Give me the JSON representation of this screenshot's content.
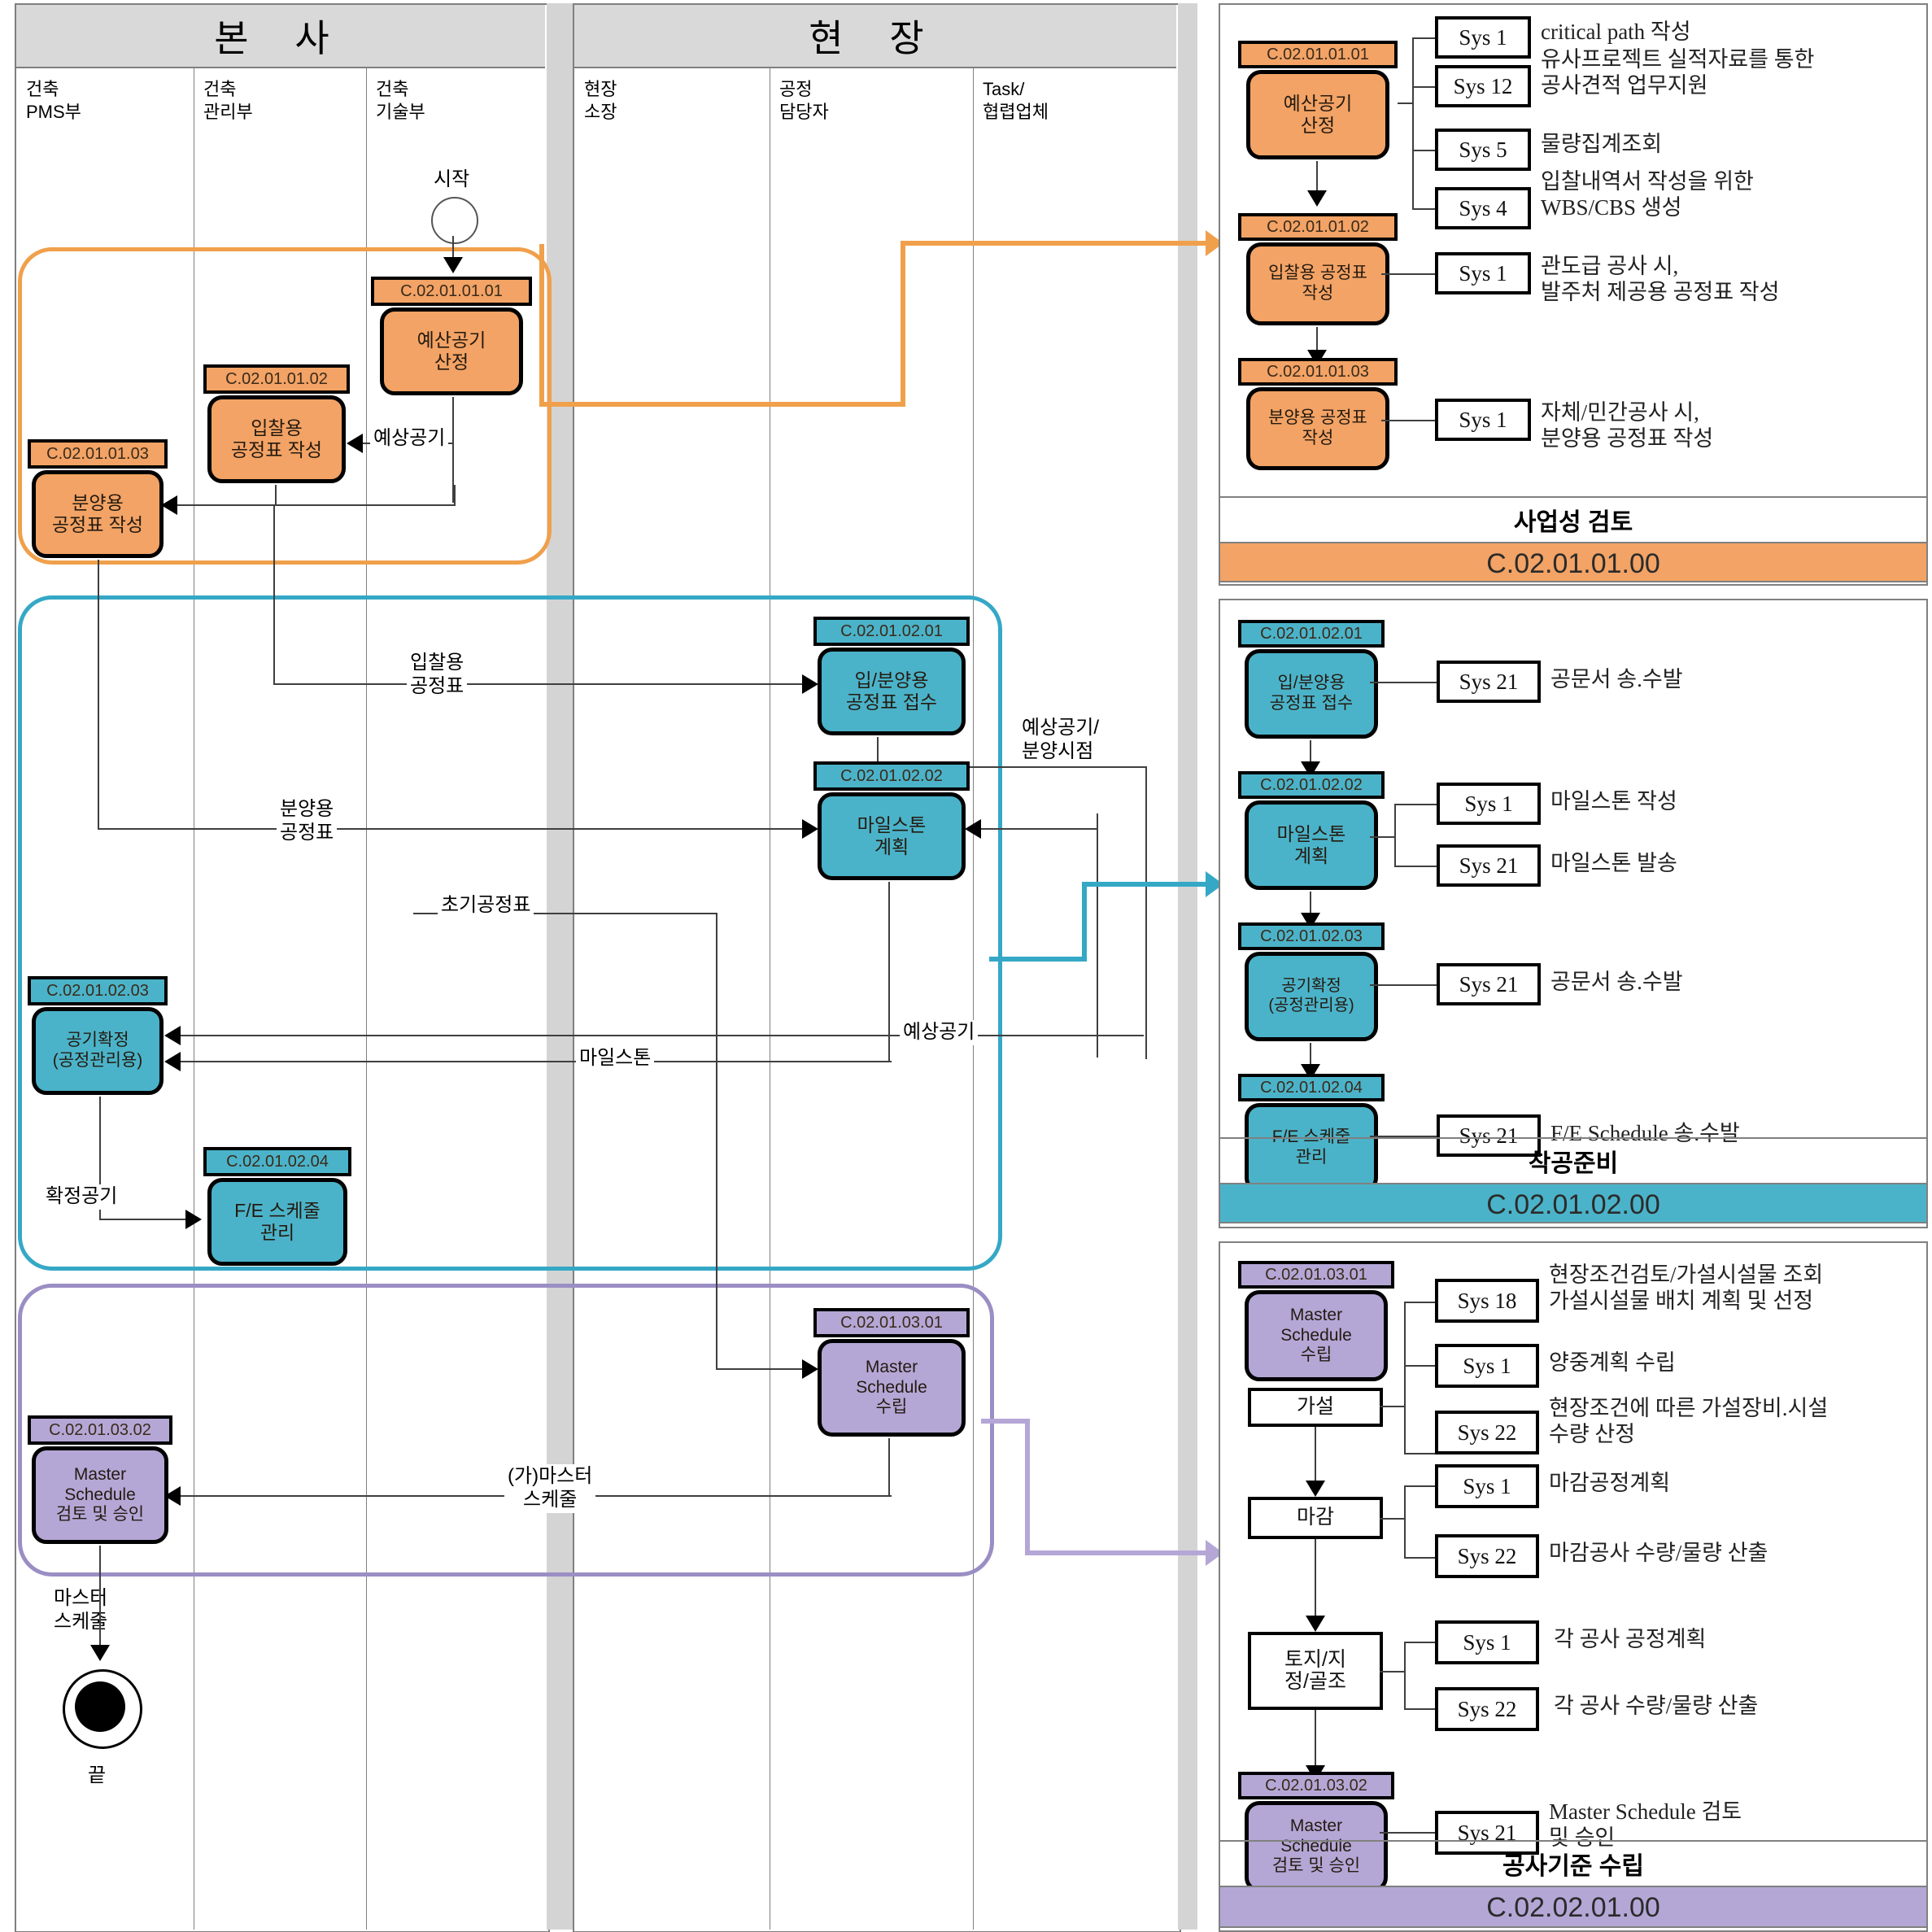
{
  "colors": {
    "orange": "#f2a365",
    "orange_outline": "#f0a04b",
    "blue": "#4bb3c9",
    "blue_outline": "#35a8c6",
    "purple": "#b4a7d6",
    "purple_outline": "#9b8ec4",
    "lane_header_bg": "#d9d9d9"
  },
  "lane_groups": [
    {
      "title": "본  사",
      "columns": [
        "건축\nPMS부",
        "건축\n관리부",
        "건축\n기술부"
      ]
    },
    {
      "title": "현  장",
      "columns": [
        "현장\n소장",
        "공정\n담당자",
        "Task/\n협렵업체"
      ]
    }
  ],
  "start": {
    "label": "시작"
  },
  "end": {
    "label": "끝"
  },
  "flow_nodes": [
    {
      "id": "n1",
      "code": "C.02.01.01.01",
      "label": "예산공기\n산정",
      "phase": "orange"
    },
    {
      "id": "n2",
      "code": "C.02.01.01.02",
      "label": "입찰용\n공정표 작성",
      "phase": "orange"
    },
    {
      "id": "n3",
      "code": "C.02.01.01.03",
      "label": "분양용\n공정표 작성",
      "phase": "orange"
    },
    {
      "id": "n4",
      "code": "C.02.01.02.01",
      "label": "입/분양용\n공정표 접수",
      "phase": "blue"
    },
    {
      "id": "n5",
      "code": "C.02.01.02.02",
      "label": "마일스톤\n계획",
      "phase": "blue"
    },
    {
      "id": "n6",
      "code": "C.02.01.02.03",
      "label": "공기확정\n(공정관리용)",
      "phase": "blue"
    },
    {
      "id": "n7",
      "code": "C.02.01.02.04",
      "label": "F/E 스케줄\n관리",
      "phase": "blue"
    },
    {
      "id": "n8",
      "code": "C.02.01.03.01",
      "label": "Master\nSchedule\n수립",
      "phase": "purple"
    },
    {
      "id": "n9",
      "code": "C.02.01.03.02",
      "label": "Master\nSchedule\n검토 및 승인",
      "phase": "purple"
    }
  ],
  "flow_edge_labels": [
    "예상공기",
    "입찰용\n공정표",
    "분양용\n공정표",
    "예상공기/\n분양시점",
    "초기공정표",
    "마일스톤",
    "예상공기",
    "확정공기",
    "(가)마스터\n스케줄",
    "마스터\n스케줄"
  ],
  "panels": [
    {
      "id": "panel-orange",
      "phase": "orange",
      "title": "사업성 검토",
      "code": "C.02.01.01.00",
      "nodes": [
        {
          "code": "C.02.01.01.01",
          "label": "예산공기\n산정",
          "systems": [
            {
              "sys": "Sys 1",
              "desc": "critical path 작성"
            },
            {
              "sys": "Sys 12",
              "desc": "유사프로젝트 실적자료를 통한\n공사견적 업무지원"
            },
            {
              "sys": "Sys 5",
              "desc": "물량집계조회"
            },
            {
              "sys": "Sys 4",
              "desc": "입찰내역서 작성을 위한\nWBS/CBS 생성"
            }
          ]
        },
        {
          "code": "C.02.01.01.02",
          "label": "입찰용 공정표\n작성",
          "systems": [
            {
              "sys": "Sys 1",
              "desc": "관도급 공사 시,\n발주처 제공용 공정표 작성"
            }
          ]
        },
        {
          "code": "C.02.01.01.03",
          "label": "분양용 공정표\n작성",
          "systems": [
            {
              "sys": "Sys 1",
              "desc": "자체/민간공사 시,\n분양용 공정표 작성"
            }
          ]
        }
      ]
    },
    {
      "id": "panel-blue",
      "phase": "blue",
      "title": "착공준비",
      "code": "C.02.01.02.00",
      "nodes": [
        {
          "code": "C.02.01.02.01",
          "label": "입/분양용\n공정표 접수",
          "systems": [
            {
              "sys": "Sys 21",
              "desc": "공문서 송.수발"
            }
          ]
        },
        {
          "code": "C.02.01.02.02",
          "label": "마일스톤\n계획",
          "systems": [
            {
              "sys": "Sys 1",
              "desc": "마일스톤 작성"
            },
            {
              "sys": "Sys 21",
              "desc": "마일스톤 발송"
            }
          ]
        },
        {
          "code": "C.02.01.02.03",
          "label": "공기확정\n(공정관리용)",
          "systems": [
            {
              "sys": "Sys 21",
              "desc": "공문서 송.수발"
            }
          ]
        },
        {
          "code": "C.02.01.02.04",
          "label": "F/E 스케줄\n관리",
          "systems": [
            {
              "sys": "Sys 21",
              "desc": "F/E Schedule 송.수발"
            }
          ]
        }
      ]
    },
    {
      "id": "panel-purple",
      "phase": "purple",
      "title": "공사기준 수립",
      "code": "C.02.02.01.00",
      "nodes": [
        {
          "code": "C.02.01.03.01",
          "label": "Master\nSchedule\n수립",
          "systems": [
            {
              "sys": "Sys 18",
              "desc": "현장조건검토/가설시설물 조회\n가설시설물 배치 계획 및 선정"
            }
          ]
        },
        {
          "plain": "가설",
          "systems": [
            {
              "sys": "Sys 1",
              "desc": "양중계획 수립"
            },
            {
              "sys": "Sys 22",
              "desc": "현장조건에 따른 가설장비.시설\n수량 산정"
            }
          ]
        },
        {
          "plain": "마감",
          "systems": [
            {
              "sys": "Sys 1",
              "desc": "마감공정계획"
            },
            {
              "sys": "Sys 22",
              "desc": "마감공사 수량/물량 산출"
            }
          ]
        },
        {
          "plain": "토지/지\n정/골조",
          "systems": [
            {
              "sys": "Sys 1",
              "desc": "각 공사 공정계획"
            },
            {
              "sys": "Sys 22",
              "desc": "각 공사 수량/물량 산출"
            }
          ]
        },
        {
          "code": "C.02.01.03.02",
          "label": "Master\nSchedule\n검토 및 승인",
          "systems": [
            {
              "sys": "Sys 21",
              "desc": "Master Schedule 검토\n및 승인"
            }
          ]
        }
      ]
    }
  ]
}
